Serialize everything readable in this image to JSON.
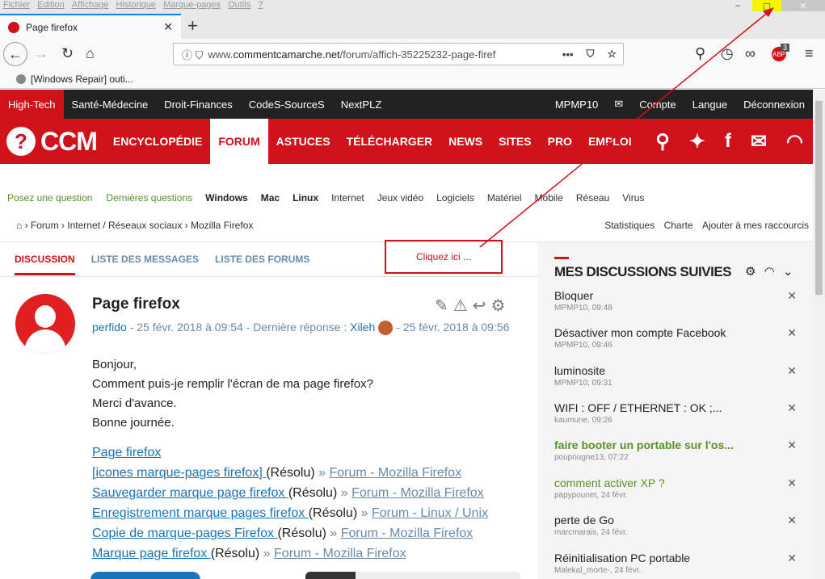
{
  "menubar": [
    "Fichier",
    "Edition",
    "Affichage",
    "Historique",
    "Marque-pages",
    "Outils",
    "?"
  ],
  "window": {
    "min": "–",
    "max": "▢",
    "close": "✕"
  },
  "tab": {
    "title": "Page firefox",
    "close": "✕",
    "new": "+"
  },
  "toolbar": {
    "url_prefix": "www.",
    "url_domain": "commentcamarche.net",
    "url_path": "/forum/affich-35225232-page-firef",
    "abp_badge": "3"
  },
  "bookmarks": [
    "[Windows Repair] outi..."
  ],
  "topnav": [
    "High-Tech",
    "Santé-Médecine",
    "Droit-Finances",
    "CodeS-SourceS",
    "NextPLZ"
  ],
  "topnav_right": [
    "MPMP10",
    "Compte",
    "Langue",
    "Déconnexion"
  ],
  "logo": "CCM",
  "mainnav": [
    "ENCYCLOPÉDIE",
    "FORUM",
    "ASTUCES",
    "TÉLÉCHARGER",
    "NEWS",
    "SITES",
    "PRO",
    "EMPLOI"
  ],
  "subnav": {
    "green": [
      "Posez une question",
      "Dernières questions"
    ],
    "bold": [
      "Windows",
      "Mac",
      "Linux"
    ],
    "normal": [
      "Internet",
      "Jeux vidéo",
      "Logiciels",
      "Matériel",
      "Mobile",
      "Réseau",
      "Virus"
    ]
  },
  "breadcrumb": [
    "Forum",
    "Internet / Réseaux sociaux",
    "Mozilla Firefox"
  ],
  "breadcrumb_right": [
    "Statistiques",
    "Charte",
    "Ajouter à mes raccourcis"
  ],
  "dtabs": [
    "DISCUSSION",
    "LISTE DES MESSAGES",
    "LISTE DES FORUMS"
  ],
  "annotation": "Cliquez ici ...",
  "post": {
    "title": "Page firefox",
    "author": "perfido",
    "date": "25 févr. 2018 à 09:54",
    "last_label": "Dernière réponse :",
    "last_user": "Xileh",
    "last_date": "25 févr. 2018 à 09:56",
    "body": [
      "Bonjour,",
      "Comment puis-je remplir l'écran de ma page firefox?",
      "Merci d'avance.",
      "Bonne journée."
    ]
  },
  "links": [
    {
      "title": "Page firefox",
      "status": "",
      "forum": ""
    },
    {
      "title": "[icones marque-pages firefox] ",
      "status": "(Résolu)",
      "forum": "Forum - Mozilla Firefox"
    },
    {
      "title": "Sauvegarder marque page firefox ",
      "status": "(Résolu)",
      "forum": "Forum - Mozilla Firefox"
    },
    {
      "title": "Enregistrement marque pages firefox ",
      "status": "(Résolu)",
      "forum": "Forum - Linux / Unix"
    },
    {
      "title": "Copie de marque-pages Firefox ",
      "status": "(Résolu)",
      "forum": "Forum - Mozilla Firefox"
    },
    {
      "title": "Marque page firefox ",
      "status": "(Résolu)",
      "forum": "Forum - Mozilla Firefox"
    }
  ],
  "sidebar": {
    "title": "MES DISCUSSIONS SUIVIES",
    "items": [
      {
        "title": "Bloquer",
        "meta": "MPMP10, 09:48",
        "style": ""
      },
      {
        "title": "Désactiver mon compte Facebook",
        "meta": "MPMP10, 09:46",
        "style": ""
      },
      {
        "title": "luminosite",
        "meta": "MPMP10, 09:31",
        "style": ""
      },
      {
        "title": "WIFI : OFF / ETHERNET : OK ;...",
        "meta": "kaumune, 09:26",
        "style": ""
      },
      {
        "title": "faire booter un portable sur l'os...",
        "meta": "poupougne13, 07:22",
        "style": "green"
      },
      {
        "title": "comment activer XP ?",
        "meta": "papypounet, 24 févr.",
        "style": "greenl"
      },
      {
        "title": "perte de Go",
        "meta": "marcmarais, 24 févr.",
        "style": ""
      },
      {
        "title": "Réinitialisation PC portable",
        "meta": "Malekal_morte-, 24 févr.",
        "style": ""
      }
    ]
  },
  "colors": {
    "brand_red": "#d0101b",
    "link_blue": "#1a73b8",
    "green": "#5a8f2a",
    "firefox_blue": "#0a84ff"
  }
}
